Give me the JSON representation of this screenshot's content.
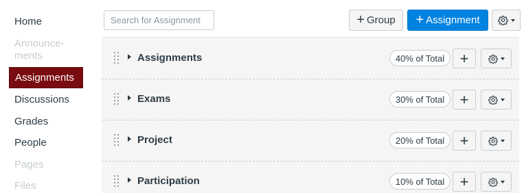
{
  "sidebar": {
    "items": [
      {
        "label": "Home",
        "state": "normal"
      },
      {
        "label": "Announce-\nments",
        "state": "disabled"
      },
      {
        "label": "Assignments",
        "state": "active"
      },
      {
        "label": "Discussions",
        "state": "normal"
      },
      {
        "label": "Grades",
        "state": "normal"
      },
      {
        "label": "People",
        "state": "normal"
      },
      {
        "label": "Pages",
        "state": "disabled"
      },
      {
        "label": "Files",
        "state": "disabled"
      }
    ]
  },
  "toolbar": {
    "search_placeholder": "Search for Assignment",
    "group_button": {
      "icon": "plus-icon",
      "label": "Group"
    },
    "assignment_button": {
      "icon": "plus-icon",
      "label": "Assignment"
    },
    "settings_button": {
      "icon": "gear-icon"
    }
  },
  "groups": [
    {
      "title": "Assignments",
      "weight": "40% of Total"
    },
    {
      "title": "Exams",
      "weight": "30% of Total"
    },
    {
      "title": "Project",
      "weight": "20% of Total"
    },
    {
      "title": "Participation",
      "weight": "10% of Total"
    }
  ],
  "colors": {
    "active_nav": "#7a0b10",
    "primary_button": "#0083e0",
    "panel_background": "#f5f5f5",
    "disabled_text": "#c7cdd1"
  }
}
